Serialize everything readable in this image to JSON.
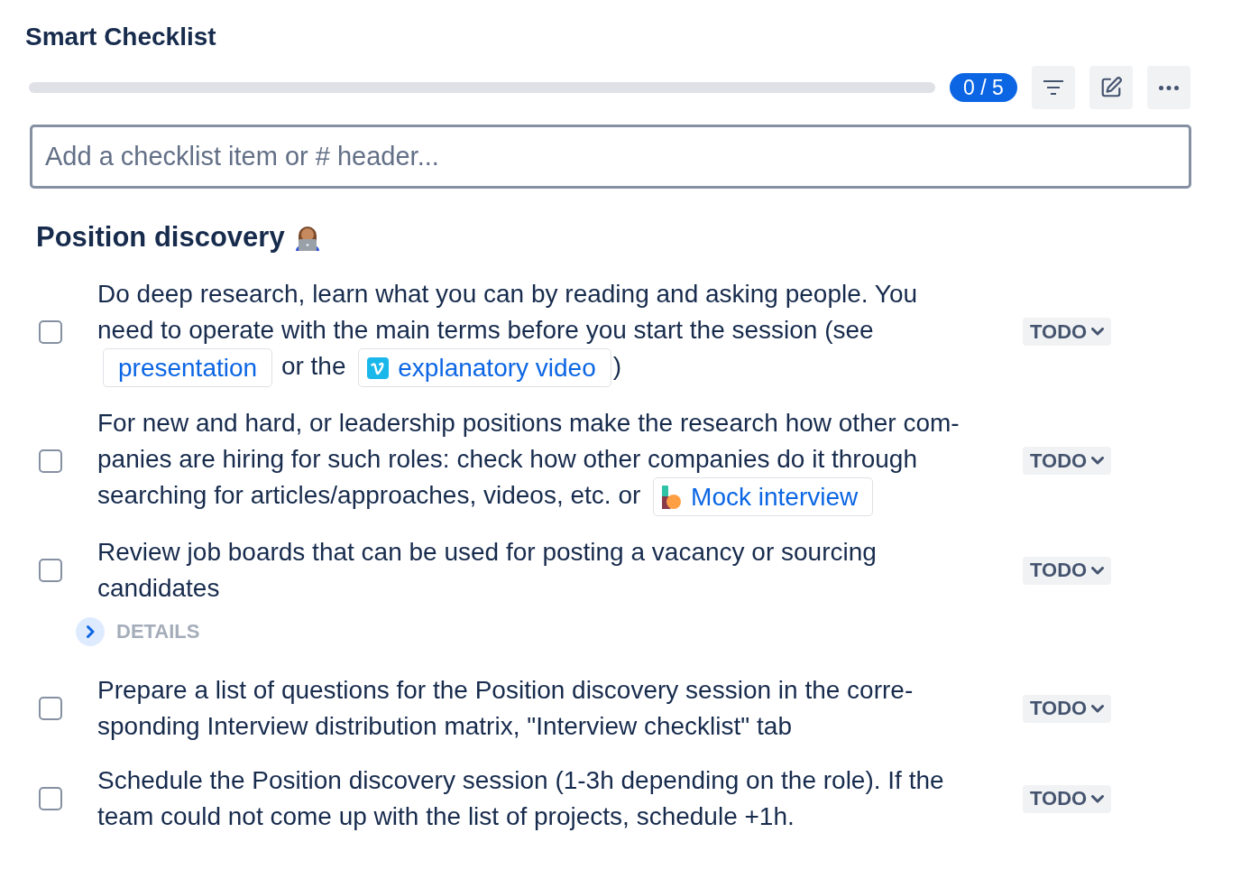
{
  "title": "Smart Checklist",
  "progress": {
    "level": 0,
    "count": "0 / 5"
  },
  "toolbar": [
    {
      "kind": "filter"
    },
    {
      "kind": "edit"
    },
    {
      "kind": "more"
    }
  ],
  "new_item": {
    "placeholder": "Add a checklist item or # header..."
  },
  "sections": [
    {
      "title": "Position discovery",
      "items": [
        {
          "checked": false,
          "content": [
            {
              "kind": "text",
              "text": "Do deep research, learn what you can by reading and asking people. You need to operate with the main terms before you start the session (see "
            },
            {
              "kind": "link",
              "text": "presentation"
            },
            {
              "kind": "text",
              "text": " or the "
            },
            {
              "kind": "video_link",
              "text": "explanatory video"
            },
            {
              "kind": "text",
              "text": ")"
            }
          ],
          "status": "TODO"
        },
        {
          "checked": false,
          "content": [
            {
              "kind": "text",
              "text": "For new and hard, or leadership positions make the research how other com-panies are hiring for such roles: check how other companies do it through searching for articles/approaches, videos, etc. or "
            },
            {
              "kind": "app_link",
              "text": "Mock interview"
            }
          ],
          "status": "TODO"
        },
        {
          "checked": false,
          "content": [
            {
              "kind": "text",
              "text": "Review job boards that can be used for posting a vacancy or sourcing candidates"
            }
          ],
          "status": "TODO",
          "details": {
            "label": "DETAILS",
            "expanded": false
          }
        },
        {
          "checked": false,
          "content": [
            {
              "kind": "text",
              "text": "Prepare a list of questions for the Position discovery session in the corre-sponding Interview distribution matrix, \"Interview checklist\" tab"
            }
          ],
          "status": "TODO"
        },
        {
          "checked": false,
          "content": [
            {
              "kind": "text",
              "text": "Schedule the Position discovery session (1-3h depending on the role). If the team could not come up with the list of projects, schedule +1h."
            }
          ],
          "status": "TODO"
        }
      ]
    }
  ]
}
